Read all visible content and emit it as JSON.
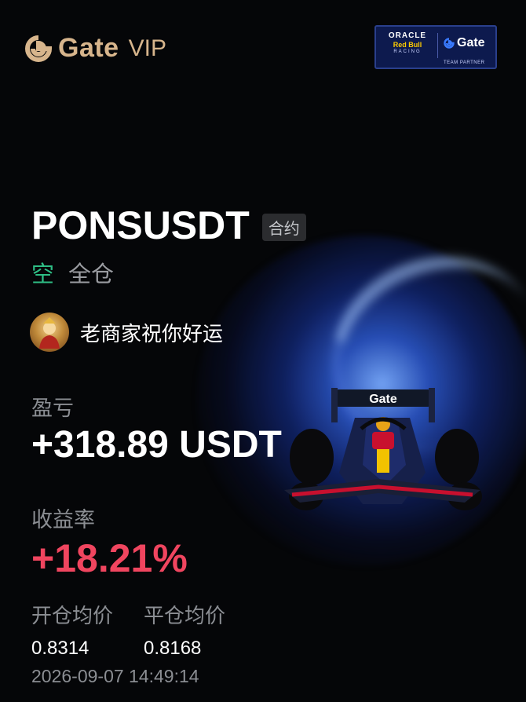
{
  "header": {
    "brand_name": "Gate",
    "brand_vip": "VIP",
    "brand_color": "#d7b58c",
    "partner": {
      "oracle": "ORACLE",
      "redbull": "Red Bull",
      "racing": "RACING",
      "gate": "Gate",
      "tag": "TEAM PARTNER"
    }
  },
  "trade": {
    "symbol": "PONSUSDT",
    "contract_badge": "合约",
    "direction": "空",
    "margin_mode": "全仓"
  },
  "user": {
    "name": "老商家祝你好运"
  },
  "pnl": {
    "label": "盈亏",
    "value": "+318.89 USDT"
  },
  "roi": {
    "label": "收益率",
    "value": "+18.21%"
  },
  "prices": {
    "entry_label": "开仓均价",
    "entry_value": "0.8314",
    "exit_label": "平仓均价",
    "exit_value": "0.8168"
  },
  "timestamp": "2026-09-07 14:49:14",
  "colors": {
    "short": "#2ebd85",
    "roi": "#f0455f",
    "background": "#050608"
  }
}
